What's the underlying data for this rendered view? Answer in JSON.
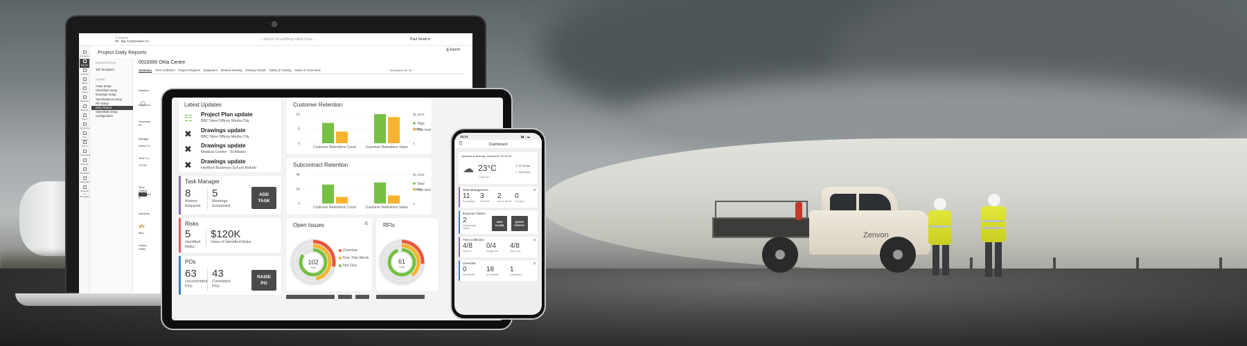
{
  "laptop": {
    "company_label": "Company",
    "company_name": "00 - Big Construction Co.",
    "search_placeholder": "Search for anything within Zenv...",
    "user_name": "Paul Smart",
    "page_title": "Project Daily Reports",
    "export_label": "Export",
    "rail": [
      "Job Admin",
      "Reports",
      "Projects",
      "Safety",
      "Assets",
      "Schedule",
      "Records",
      "Users",
      "Resources",
      "Time Collect",
      "Forms",
      "Timesheets",
      "Settings",
      "Templates",
      "Notifications",
      "Contacts & Messages"
    ],
    "sidebar": {
      "group_admin": "ADMINISTRATION",
      "job_templates": "Job Templates",
      "group_global": "GLOBAL",
      "items": [
        "Asset Setup",
        "Checklists Setup",
        "Drawings Setup",
        "Specifications Setup",
        "RFI Setup",
        "Daily Report",
        "Submittals Setup",
        "Configuration"
      ],
      "active_index": 5
    },
    "project_title": "0015000 Ohta Centre",
    "tabs": [
      "Summary",
      "Time Collection",
      "Project Progress",
      "Equipment",
      "Material tracking",
      "Delivery Details",
      "Safety & Training",
      "Notes or Comments"
    ],
    "active_tab": 0,
    "date_label": "November 25, 18",
    "left_labels": [
      "Weather",
      "Weekend",
      "Summary Inf",
      "Manage",
      "Home Co",
      "Time Co",
      "13 Oct",
      "Time Collect",
      "Employee N",
      "Incidents",
      "Time",
      "Mon",
      "Safety Statis"
    ]
  },
  "tablet": {
    "latest_updates": {
      "title": "Latest Updates",
      "items": [
        {
          "title": "Project Plan update",
          "subtitle": "BBC New Offices Media City",
          "icon": "gantt-icon"
        },
        {
          "title": "Drawings update",
          "subtitle": "BBC New Offices Media City",
          "icon": "tools-icon"
        },
        {
          "title": "Drawings update",
          "subtitle": "Medical Centre - St Albans",
          "icon": "tools-icon"
        },
        {
          "title": "Drawings update",
          "subtitle": "Hertford Business School Refurb",
          "icon": "tools-icon"
        }
      ]
    },
    "task_manager": {
      "title": "Task Manager",
      "stat1_num": "8",
      "stat1_lbl_a": "Actions",
      "stat1_lbl_b": "Required",
      "stat2_num": "5",
      "stat2_lbl_a": "Meetings",
      "stat2_lbl_b": "Scheduled",
      "btn_a": "ADD",
      "btn_b": "TASK",
      "accent": "#8e6bb5"
    },
    "risks": {
      "title": "Risks",
      "stat1_num": "5",
      "stat1_lbl_a": "Identified",
      "stat1_lbl_b": "Risks",
      "stat2_num": "$120K",
      "stat2_lbl_a": "Value of Identified Risks",
      "accent": "#e05b5b"
    },
    "pos": {
      "title": "POs",
      "stat1_num": "63",
      "stat1_lbl_a": "Uncommitted",
      "stat1_lbl_b": "POs",
      "stat2_num": "43",
      "stat2_lbl_a": "Committed",
      "stat2_lbl_b": "POs",
      "btn_a": "RAISE",
      "btn_b": "PO",
      "accent": "#3d7fc4"
    },
    "customer_retention": {
      "title": "Customer Retention",
      "y_ticks": [
        "10",
        "5",
        "0"
      ],
      "y2_ticks": [
        "$1,000K",
        "$500K",
        "0"
      ],
      "categories": [
        "Customer Retentions Count",
        "Customer Retentions Value"
      ],
      "legend": [
        "Total",
        "Due next month"
      ]
    },
    "subcontract_retention": {
      "title": "Subcontract Retention",
      "y_ticks": [
        "40",
        "20",
        "0"
      ],
      "y2_ticks": [
        "$1,000K",
        "$500K",
        "0"
      ],
      "categories": [
        "Customer Retentions Count",
        "Customer Retentions Value"
      ],
      "legend": [
        "Total",
        "Due next month"
      ]
    },
    "open_issues": {
      "title": "Open Issues",
      "total": "102",
      "total_label": "Total",
      "legend": [
        "Overdue",
        "Due This Week",
        "Not Due"
      ]
    },
    "rfis": {
      "title": "RFIs",
      "total": "61",
      "total_label": "Total"
    }
  },
  "phone": {
    "status_time": "10:21",
    "screen_title": "Dashboard",
    "updated": "Updated at Monday, November 25 10:18",
    "temperature": "23°C",
    "weather_desc": "Light rain",
    "sunrise": "07:06 am",
    "sunset": "04:02 pm",
    "task_mgmt": {
      "title": "Task Management",
      "stats": [
        {
          "n": "11",
          "l": "In progress"
        },
        {
          "n": "3",
          "l": "Overdue"
        },
        {
          "n": "2",
          "l": "Due in 48 hrs"
        },
        {
          "n": "0",
          "l": "In Query"
        }
      ]
    },
    "expense": {
      "title": "Expense Claims",
      "n": "2",
      "l": "Outstanding claims",
      "btn1_a": "ADD",
      "btn1_b": "CLAIM",
      "btn2_a": "QUICK",
      "btn2_b": "PHOTO"
    },
    "time_collection": {
      "title": "Time Collection",
      "stats": [
        {
          "n": "4/8",
          "l": "Clock In"
        },
        {
          "n": "0/4",
          "l": "Assign Job"
        },
        {
          "n": "4/8",
          "l": "Clock Out"
        }
      ]
    },
    "checklist": {
      "title": "Checklist",
      "stats": [
        {
          "n": "0",
          "l": "Not Started"
        },
        {
          "n": "18",
          "l": "In Progress"
        },
        {
          "n": "1",
          "l": "Completed"
        }
      ]
    }
  },
  "scene": {
    "truck_logo": "Zenvon"
  },
  "colors": {
    "green": "#76c043",
    "orange": "#f7b32b",
    "red": "#e9573f",
    "dark_button": "#4a4a4a"
  },
  "chart_data": [
    {
      "type": "bar",
      "title": "Customer Retention",
      "categories": [
        "Customer Retentions Count",
        "Customer Retentions Value"
      ],
      "series": [
        {
          "name": "Total",
          "values": [
            7,
            10
          ]
        },
        {
          "name": "Due next month",
          "values": [
            4,
            9
          ]
        }
      ],
      "ylim": [
        0,
        10
      ]
    },
    {
      "type": "bar",
      "title": "Subcontract Retention",
      "categories": [
        "Customer Retentions Count",
        "Customer Retentions Value"
      ],
      "series": [
        {
          "name": "Total",
          "values": [
            26,
            29
          ]
        },
        {
          "name": "Due next month",
          "values": [
            9,
            11
          ]
        }
      ],
      "ylim": [
        0,
        40
      ]
    },
    {
      "type": "pie",
      "title": "Open Issues",
      "categories": [
        "Overdue",
        "Due This Week",
        "Not Due"
      ],
      "values": [
        18,
        30,
        54
      ]
    },
    {
      "type": "pie",
      "title": "RFIs",
      "categories": [
        "Overdue",
        "Due This Week",
        "Not Due"
      ],
      "values": [
        10,
        15,
        36
      ]
    }
  ]
}
